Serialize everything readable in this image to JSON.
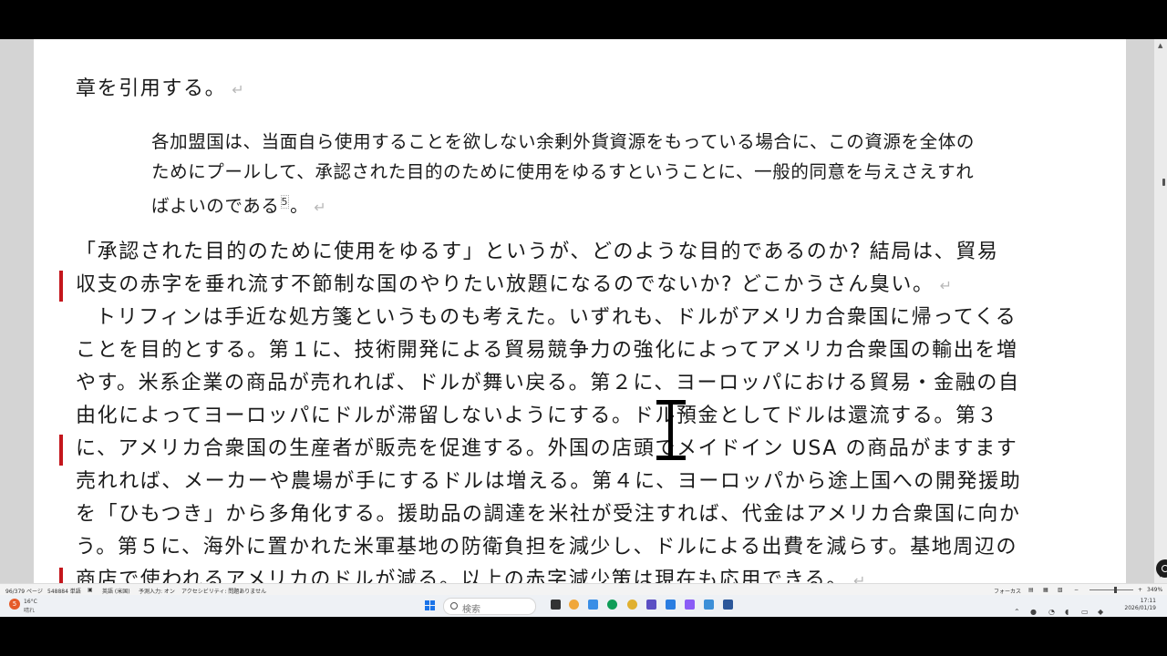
{
  "document": {
    "lines": [
      "章を引用する。",
      "各加盟国は、当面自ら使用することを欲しない余剰外貨資源をもっている場合に、この資源を全体の",
      "ためにプールして、承認された目的のために使用をゆるすということに、一般的同意を与えさえすれ",
      "ばよいのである",
      "5",
      "。",
      "「承認された目的のために使用をゆるす」というが、どのような目的であるのか? 結局は、貿易",
      "収支の赤字を垂れ流す不節制な国のやりたい放題になるのでないか? どこかうさん臭い。",
      "トリフィンは手近な処方箋というものも考えた。いずれも、ドルがアメリカ合衆国に帰ってくる",
      "ことを目的とする。第１に、技術開発による貿易競争力の強化によってアメリカ合衆国の輸出を増",
      "やす。米系企業の商品が売れれば、ドルが舞い戻る。第２に、ヨーロッパにおける貿易・金融の自",
      "由化によってヨーロッパにドルが滞留しないようにする。ドル預金としてドルは還流する。第３",
      "に、アメリカ合衆国の生産者が販売を促進する。外国の店頭でメイドイン USA の商品がますます",
      "売れれば、メーカーや農場が手にするドルは増える。第４に、ヨーロッパから途上国への開発援助",
      "を「ひもつき」から多角化する。援助品の調達を米社が受注すれば、代金はアメリカ合衆国に向か",
      "う。第５に、海外に置かれた米軍基地の防衛負担を減少し、ドルによる出費を減らす。基地周辺の",
      "商店で使われるアメリカのドルが減る。以上の赤字減少策は現在も応用できる。"
    ],
    "paragraph_mark": "↵"
  },
  "status_bar": {
    "page": "96/379 ページ",
    "words": "548884 単語",
    "lang": "英語 (米国)",
    "input": "予測入力: オン",
    "accessibility": "アクセシビリティ: 問題ありません",
    "focus": "フォーカス",
    "zoom": "349%"
  },
  "taskbar": {
    "search_placeholder": "検索",
    "weather_badge": "5",
    "weather_temp": "16°C",
    "weather_desc": "晴れ",
    "time": "17:11",
    "date": "2026/01/19"
  },
  "colors": {
    "change_bar": "#c4161c",
    "page_bg": "#ffffff",
    "workspace_bg": "#d4d4d4"
  }
}
